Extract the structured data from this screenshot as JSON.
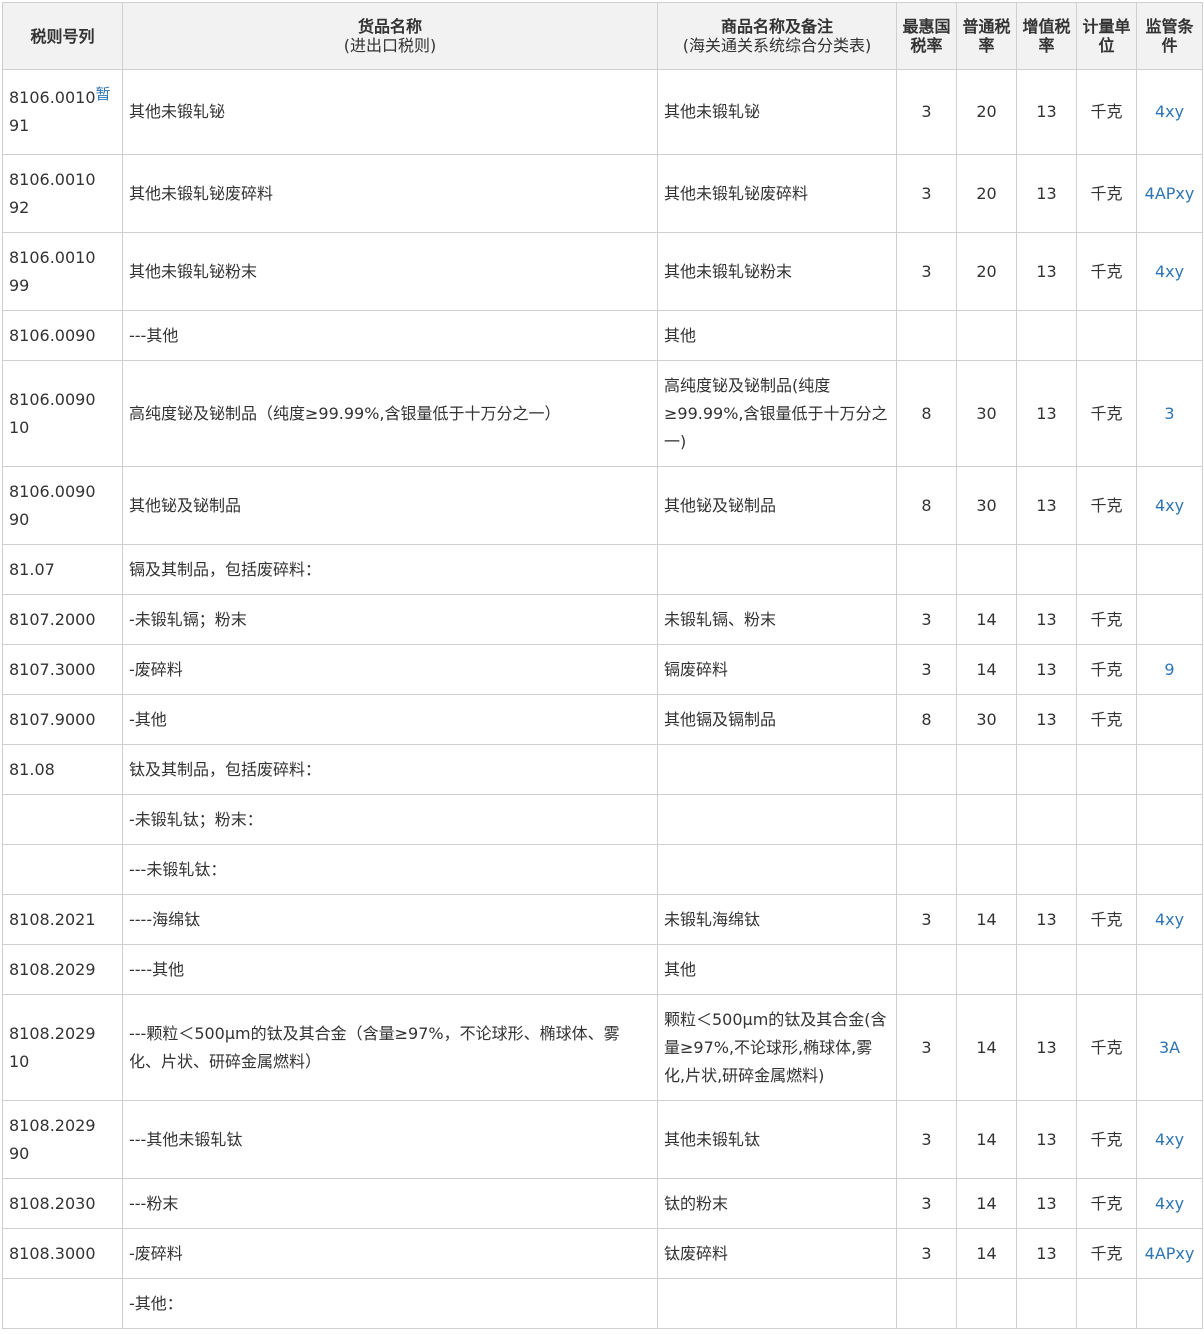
{
  "headers": {
    "code": "税则号列",
    "name": "货品名称",
    "name_sub": "(进出口税则)",
    "goods": "商品名称及备注",
    "goods_sub": "(海关通关系统综合分类表)",
    "mfn": "最惠国税率",
    "general": "普通税率",
    "vat": "增值税率",
    "unit": "计量单位",
    "supervision": "监管条件"
  },
  "rows": [
    {
      "code": "8106.0010",
      "code_suffix": "91",
      "flag": "暂",
      "name": "其他未锻轧铋",
      "goods": "其他未锻轧铋",
      "mfn": "3",
      "general": "20",
      "vat": "13",
      "unit": "千克",
      "supervision": "4xy"
    },
    {
      "code": "8106.0010",
      "code_suffix": "92",
      "flag": "",
      "name": "其他未锻轧铋废碎料",
      "goods": "其他未锻轧铋废碎料",
      "mfn": "3",
      "general": "20",
      "vat": "13",
      "unit": "千克",
      "supervision": "4APxy"
    },
    {
      "code": "8106.0010",
      "code_suffix": "99",
      "flag": "",
      "name": "其他未锻轧铋粉末",
      "goods": "其他未锻轧铋粉末",
      "mfn": "3",
      "general": "20",
      "vat": "13",
      "unit": "千克",
      "supervision": "4xy"
    },
    {
      "code": "8106.0090",
      "code_suffix": "",
      "flag": "",
      "name": "---其他",
      "goods": "其他",
      "mfn": "",
      "general": "",
      "vat": "",
      "unit": "",
      "supervision": ""
    },
    {
      "code": "8106.0090",
      "code_suffix": "10",
      "flag": "",
      "name": "高纯度铋及铋制品（纯度≥99.99%,含银量低于十万分之一）",
      "goods": "高纯度铋及铋制品(纯度≥99.99%,含银量低于十万分之一)",
      "mfn": "8",
      "general": "30",
      "vat": "13",
      "unit": "千克",
      "supervision": "3"
    },
    {
      "code": "8106.0090",
      "code_suffix": "90",
      "flag": "",
      "name": "其他铋及铋制品",
      "goods": "其他铋及铋制品",
      "mfn": "8",
      "general": "30",
      "vat": "13",
      "unit": "千克",
      "supervision": "4xy"
    },
    {
      "code": "81.07",
      "code_suffix": "",
      "flag": "",
      "name": "镉及其制品，包括废碎料：",
      "goods": "",
      "mfn": "",
      "general": "",
      "vat": "",
      "unit": "",
      "supervision": ""
    },
    {
      "code": "8107.2000",
      "code_suffix": "",
      "flag": "",
      "name": "-未锻轧镉；粉末",
      "goods": "未锻轧镉、粉末",
      "mfn": "3",
      "general": "14",
      "vat": "13",
      "unit": "千克",
      "supervision": ""
    },
    {
      "code": "8107.3000",
      "code_suffix": "",
      "flag": "",
      "name": "-废碎料",
      "goods": "镉废碎料",
      "mfn": "3",
      "general": "14",
      "vat": "13",
      "unit": "千克",
      "supervision": "9"
    },
    {
      "code": "8107.9000",
      "code_suffix": "",
      "flag": "",
      "name": "-其他",
      "goods": "其他镉及镉制品",
      "mfn": "8",
      "general": "30",
      "vat": "13",
      "unit": "千克",
      "supervision": ""
    },
    {
      "code": "81.08",
      "code_suffix": "",
      "flag": "",
      "name": "钛及其制品，包括废碎料：",
      "goods": "",
      "mfn": "",
      "general": "",
      "vat": "",
      "unit": "",
      "supervision": ""
    },
    {
      "code": "",
      "code_suffix": "",
      "flag": "",
      "name": "-未锻轧钛；粉末：",
      "goods": "",
      "mfn": "",
      "general": "",
      "vat": "",
      "unit": "",
      "supervision": ""
    },
    {
      "code": "",
      "code_suffix": "",
      "flag": "",
      "name": "---未锻轧钛：",
      "goods": "",
      "mfn": "",
      "general": "",
      "vat": "",
      "unit": "",
      "supervision": ""
    },
    {
      "code": "8108.2021",
      "code_suffix": "",
      "flag": "",
      "name": "----海绵钛",
      "goods": "未锻轧海绵钛",
      "mfn": "3",
      "general": "14",
      "vat": "13",
      "unit": "千克",
      "supervision": "4xy"
    },
    {
      "code": "8108.2029",
      "code_suffix": "",
      "flag": "",
      "name": "----其他",
      "goods": "其他",
      "mfn": "",
      "general": "",
      "vat": "",
      "unit": "",
      "supervision": ""
    },
    {
      "code": "8108.2029",
      "code_suffix": "10",
      "flag": "",
      "name": "---颗粒＜500μm的钛及其合金（含量≥97%，不论球形、椭球体、雾化、片状、研碎金属燃料）",
      "goods": "颗粒＜500μm的钛及其合金(含量≥97%,不论球形,椭球体,雾化,片状,研碎金属燃料)",
      "mfn": "3",
      "general": "14",
      "vat": "13",
      "unit": "千克",
      "supervision": "3A"
    },
    {
      "code": "8108.2029",
      "code_suffix": "90",
      "flag": "",
      "name": "---其他未锻轧钛",
      "goods": "其他未锻轧钛",
      "mfn": "3",
      "general": "14",
      "vat": "13",
      "unit": "千克",
      "supervision": "4xy"
    },
    {
      "code": "8108.2030",
      "code_suffix": "",
      "flag": "",
      "name": "---粉末",
      "goods": "钛的粉末",
      "mfn": "3",
      "general": "14",
      "vat": "13",
      "unit": "千克",
      "supervision": "4xy"
    },
    {
      "code": "8108.3000",
      "code_suffix": "",
      "flag": "",
      "name": "-废碎料",
      "goods": "钛废碎料",
      "mfn": "3",
      "general": "14",
      "vat": "13",
      "unit": "千克",
      "supervision": "4APxy"
    },
    {
      "code": "",
      "code_suffix": "",
      "flag": "",
      "name": "-其他：",
      "goods": "",
      "mfn": "",
      "general": "",
      "vat": "",
      "unit": "",
      "supervision": ""
    }
  ]
}
